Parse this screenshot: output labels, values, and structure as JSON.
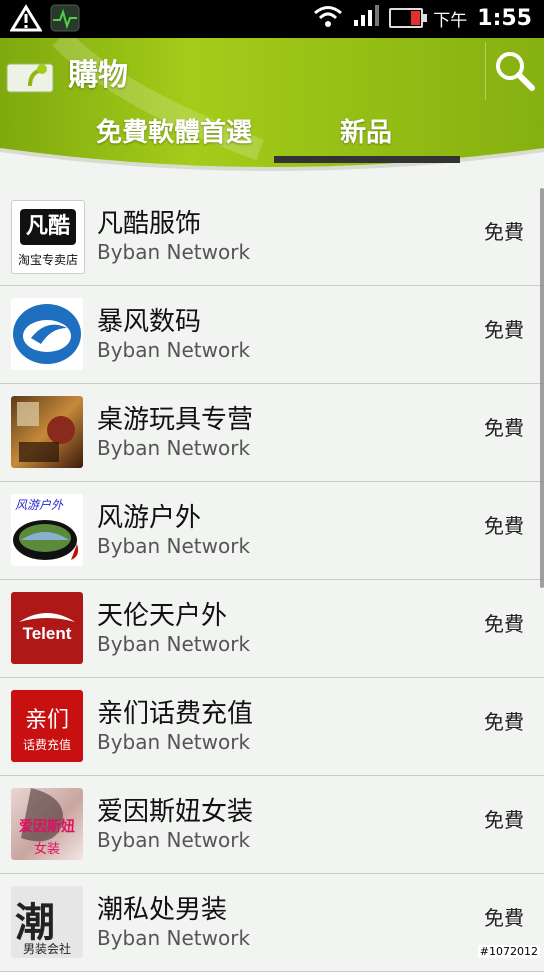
{
  "status_bar": {
    "ampm": "下午",
    "time": "1:55"
  },
  "header": {
    "title": "購物",
    "tabs": [
      {
        "label": "免費軟體首選",
        "selected": false
      },
      {
        "label": "新品",
        "selected": true
      }
    ],
    "accent_color": "#8fb814"
  },
  "items": [
    {
      "name": "凡酷服饰",
      "developer": "Byban Network",
      "price": "免費",
      "icon": "fanku-logo",
      "icon_text": "凡酷",
      "icon_sub": "淘宝专卖店"
    },
    {
      "name": "暴风数码",
      "developer": "Byban Network",
      "price": "免費",
      "icon": "baofeng-logo"
    },
    {
      "name": "桌游玩具专营",
      "developer": "Byban Network",
      "price": "免費",
      "icon": "boardgame-photo"
    },
    {
      "name": "风游户外",
      "developer": "Byban Network",
      "price": "免費",
      "icon": "fengyou-logo",
      "icon_text": "风游户外"
    },
    {
      "name": "天伦天户外",
      "developer": "Byban Network",
      "price": "免費",
      "icon": "telent-logo",
      "icon_text": "Telent"
    },
    {
      "name": "亲们话费充值",
      "developer": "Byban Network",
      "price": "免費",
      "icon": "qinmen-logo",
      "icon_text": "亲们",
      "icon_sub": "话费充值"
    },
    {
      "name": "爱因斯妞女装",
      "developer": "Byban Network",
      "price": "免費",
      "icon": "aiyinsiniu-photo",
      "icon_text": "爱因斯妞",
      "icon_sub": "女装"
    },
    {
      "name": "潮私处男装",
      "developer": "Byban Network",
      "price": "免費",
      "icon": "chaosichu-logo",
      "icon_text": "潮",
      "icon_sub": "男装会社"
    }
  ],
  "watermark": "#1072012"
}
